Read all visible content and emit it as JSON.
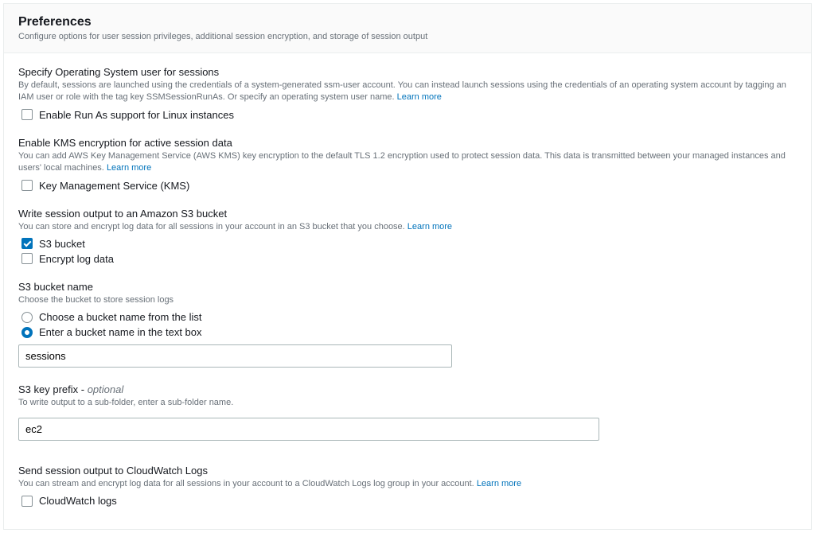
{
  "header": {
    "title": "Preferences",
    "subtitle": "Configure options for user session privileges, additional session encryption, and storage of session output"
  },
  "os_user": {
    "title": "Specify Operating System user for sessions",
    "desc_part1": "By default, sessions are launched using the credentials of a system-generated ssm-user account. You can instead launch sessions using the credentials of an operating system account by tagging an IAM user or role with the tag key SSMSessionRunAs. Or specify an operating system user name. ",
    "learn_more": "Learn more",
    "checkbox_label": "Enable Run As support for Linux instances"
  },
  "kms": {
    "title": "Enable KMS encryption for active session data",
    "desc_part1": "You can add AWS Key Management Service (AWS KMS) key encryption to the default TLS 1.2 encryption used to protect session data. This data is transmitted between your managed instances and users' local machines. ",
    "learn_more": "Learn more",
    "checkbox_label": "Key Management Service (KMS)"
  },
  "s3_output": {
    "title": "Write session output to an Amazon S3 bucket",
    "desc_part1": "You can store and encrypt log data for all sessions in your account in an S3 bucket that you choose. ",
    "learn_more": "Learn more",
    "checkbox_s3": "S3 bucket",
    "checkbox_encrypt": "Encrypt log data"
  },
  "s3_bucket": {
    "title": "S3 bucket name",
    "desc": "Choose the bucket to store session logs",
    "radio_list": "Choose a bucket name from the list",
    "radio_text": "Enter a bucket name in the text box",
    "input_value": "sessions"
  },
  "s3_prefix": {
    "title_main": "S3 key prefix - ",
    "title_optional": "optional",
    "desc": "To write output to a sub-folder, enter a sub-folder name.",
    "input_value": "ec2"
  },
  "cloudwatch": {
    "title": "Send session output to CloudWatch Logs",
    "desc_part1": "You can stream and encrypt log data for all sessions in your account to a CloudWatch Logs log group in your account. ",
    "learn_more": "Learn more",
    "checkbox_label": "CloudWatch logs"
  }
}
